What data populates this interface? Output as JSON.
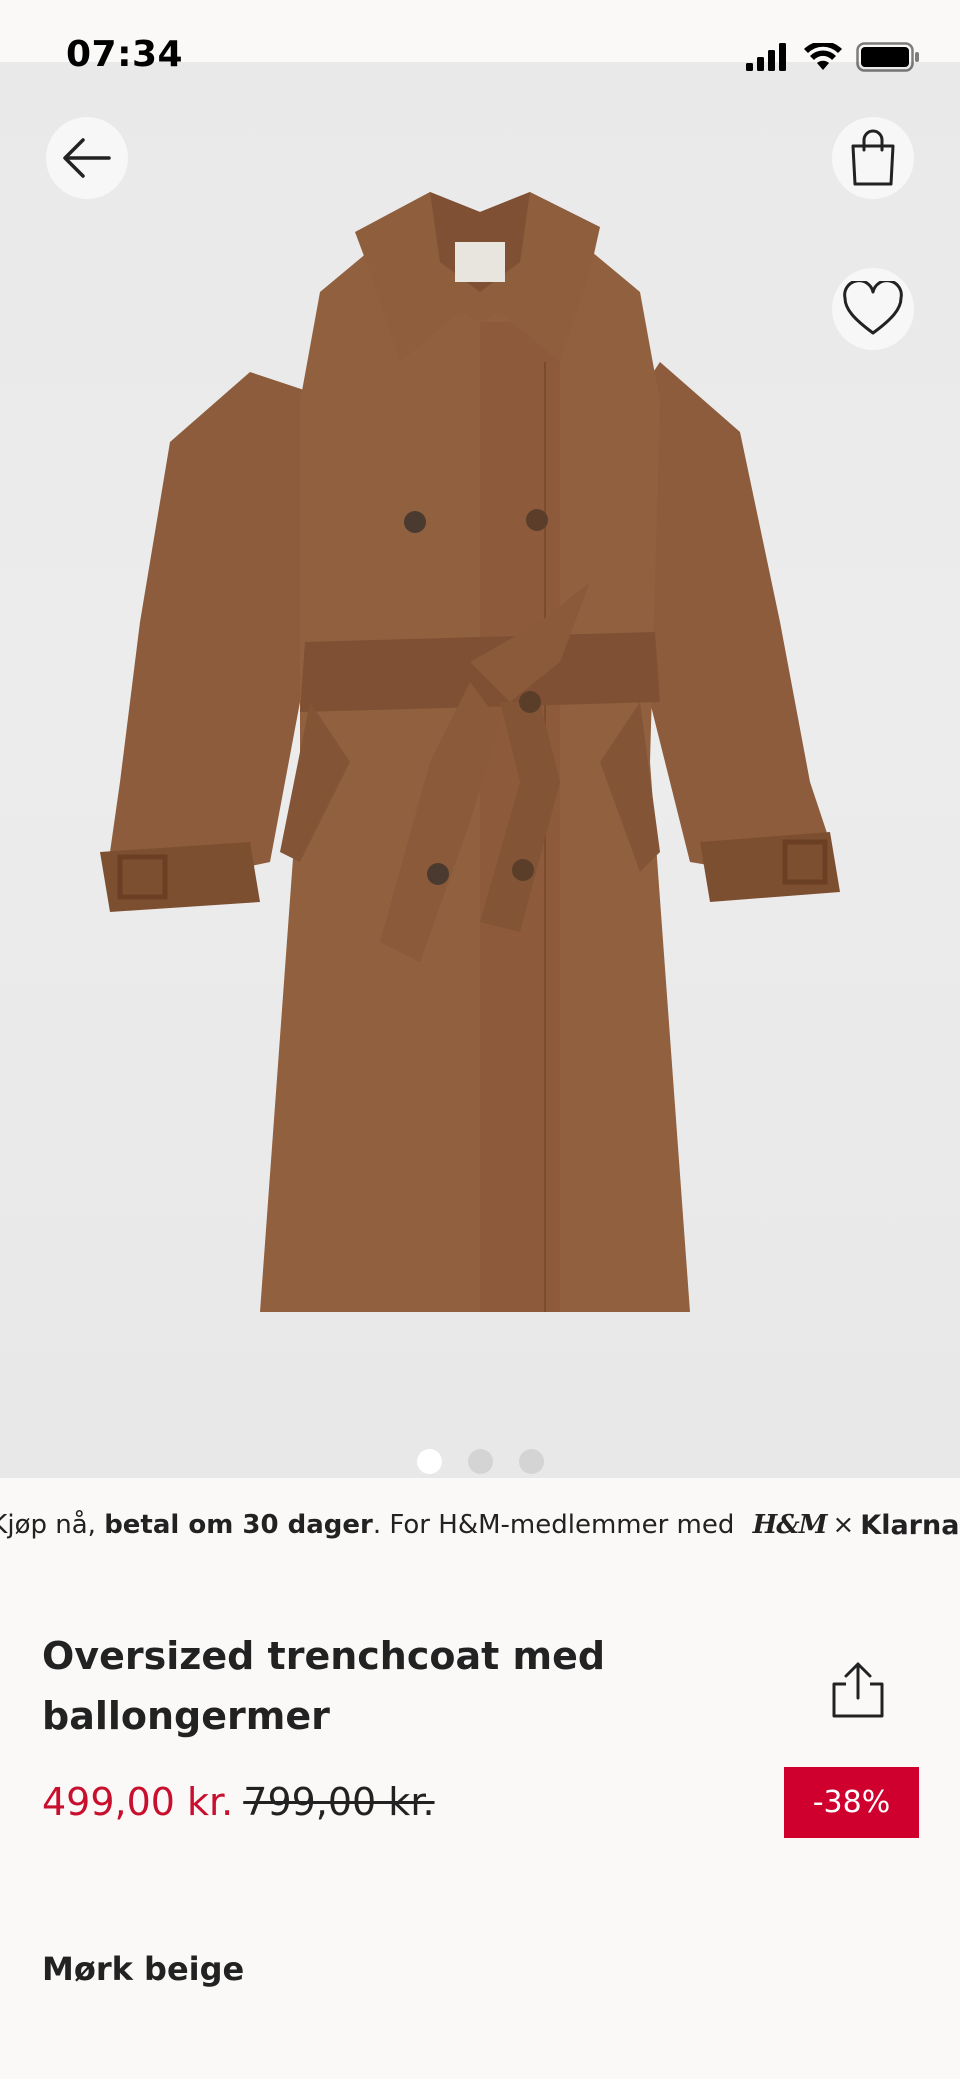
{
  "status_bar": {
    "time": "07:34"
  },
  "hero": {
    "active_image": 1,
    "image_count": 3
  },
  "payment_banner": {
    "prefix": "Kjøp nå, ",
    "bold": "betal om 30 dager",
    "suffix": ". For H&M-medlemmer med ",
    "hm_logo": "H&M",
    "times": "×",
    "klarna_logo": "Klarna."
  },
  "product": {
    "title": "Oversized trenchcoat med ballongermer",
    "price_now": "499,00 kr.",
    "price_old": "799,00 kr.",
    "discount": "-38%",
    "color": "Mørk beige"
  },
  "colors": {
    "sale_red": "#c8102e",
    "badge_red": "#d0002e",
    "coat_brown": "#8a5a3b",
    "background": "#faf9f8"
  },
  "icons": [
    "back-arrow-icon",
    "shopping-bag-icon",
    "heart-icon",
    "share-icon",
    "signal-icon",
    "wifi-icon",
    "battery-icon"
  ]
}
